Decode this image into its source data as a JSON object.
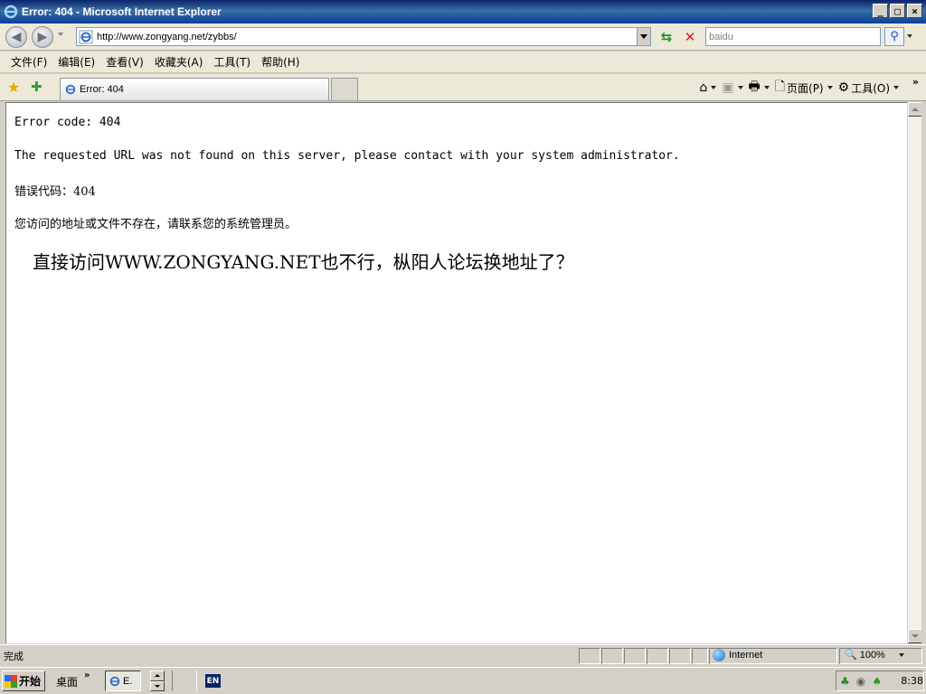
{
  "window": {
    "title": "Error: 404 - Microsoft Internet Explorer",
    "minimize": "_",
    "maximize": "□",
    "close": "×"
  },
  "address": {
    "url": "http://www.zongyang.net/zybbs/",
    "search_value": "baidu"
  },
  "menu": [
    "文件(F)",
    "编辑(E)",
    "查看(V)",
    "收藏夹(A)",
    "工具(T)",
    "帮助(H)"
  ],
  "tabs": {
    "active_label": "Error: 404"
  },
  "command_bar": {
    "page_label": "页面(P)",
    "tools_label": "工具(O)",
    "more": "»"
  },
  "content": {
    "line1": "Error code: 404",
    "line2": "The requested URL was not found on this server, please contact with your system administrator.",
    "line3": "错误代码：404",
    "line4": "您访问的地址或文件不存在，请联系您的系统管理员。",
    "line5": "直接访问WWW.ZONGYANG.NET也不行，枞阳人论坛换地址了？"
  },
  "status": {
    "text": "完成",
    "zone": "Internet",
    "zoom": "100%"
  },
  "taskbar": {
    "start": "开始",
    "quick_label": "桌面",
    "quick_chevron": "»",
    "task_label": "E.",
    "lang": "EN",
    "clock": "8:38"
  },
  "colors": {
    "titlebar": "#0a246a",
    "chrome": "#d4d0c8",
    "toolbar": "#ece9d8"
  }
}
